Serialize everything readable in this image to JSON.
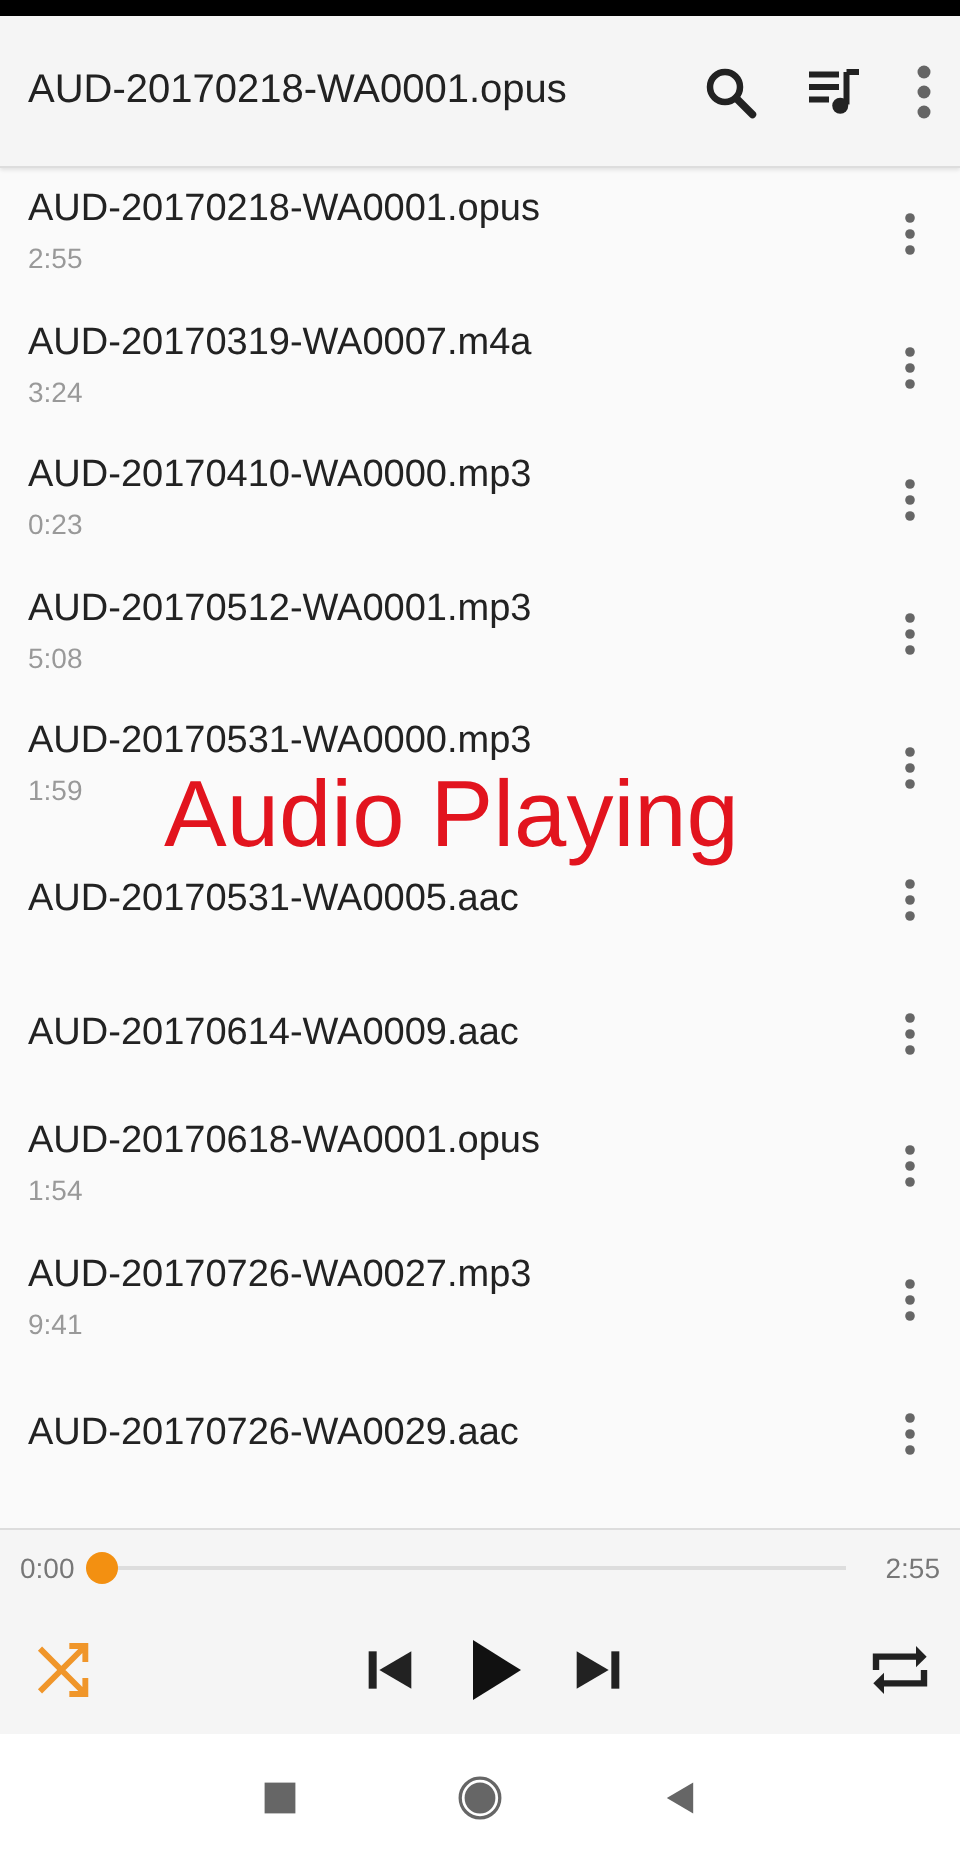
{
  "toolbar": {
    "title": "AUD-20170218-WA0001.opus"
  },
  "tracks": [
    {
      "name": "AUD-20170218-WA0001.opus",
      "duration": "2:55"
    },
    {
      "name": "AUD-20170319-WA0007.m4a",
      "duration": "3:24"
    },
    {
      "name": "AUD-20170410-WA0000.mp3",
      "duration": "0:23"
    },
    {
      "name": "AUD-20170512-WA0001.mp3",
      "duration": "5:08"
    },
    {
      "name": "AUD-20170531-WA0000.mp3",
      "duration": "1:59"
    },
    {
      "name": "AUD-20170531-WA0005.aac"
    },
    {
      "name": "AUD-20170614-WA0009.aac"
    },
    {
      "name": "AUD-20170618-WA0001.opus",
      "duration": "1:54"
    },
    {
      "name": "AUD-20170726-WA0027.mp3",
      "duration": "9:41"
    },
    {
      "name": "AUD-20170726-WA0029.aac"
    }
  ],
  "overlay_caption": "Audio Playing",
  "player": {
    "elapsed": "0:00",
    "total": "2:55",
    "level": 0,
    "shuffle": true,
    "repeat": false,
    "playing": false
  }
}
